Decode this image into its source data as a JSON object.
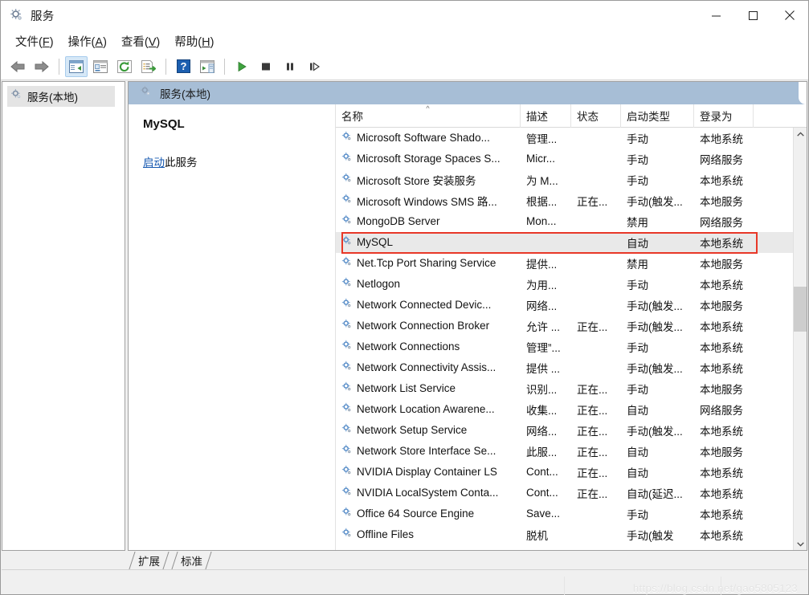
{
  "window": {
    "title": "服务",
    "icon": "services-gear-icon",
    "minimize_label": "最小化",
    "maximize_label": "最大化",
    "close_label": "关闭"
  },
  "menubar": {
    "items": [
      {
        "label": "文件(F)",
        "text": "文件(",
        "accel": "F",
        "tail": ")"
      },
      {
        "label": "操作(A)",
        "text": "操作(",
        "accel": "A",
        "tail": ")"
      },
      {
        "label": "查看(V)",
        "text": "查看(",
        "accel": "V",
        "tail": ")"
      },
      {
        "label": "帮助(H)",
        "text": "帮助(",
        "accel": "H",
        "tail": ")"
      }
    ]
  },
  "toolbar": {
    "buttons": [
      {
        "name": "back-icon",
        "title": "后退"
      },
      {
        "name": "forward-icon",
        "title": "前进"
      },
      {
        "name": "show-hide-tree-icon",
        "title": "显示/隐藏控制台树",
        "active": true
      },
      {
        "name": "properties-icon",
        "title": "属性"
      },
      {
        "name": "refresh-icon",
        "title": "刷新"
      },
      {
        "name": "export-list-icon",
        "title": "导出列表"
      },
      {
        "name": "help-icon",
        "title": "帮助"
      },
      {
        "name": "show-action-pane-icon",
        "title": "显示操作窗格"
      },
      {
        "name": "start-service-icon",
        "title": "启动服务"
      },
      {
        "name": "stop-service-icon",
        "title": "停止服务"
      },
      {
        "name": "pause-service-icon",
        "title": "暂停服务"
      },
      {
        "name": "restart-service-icon",
        "title": "重启服务"
      }
    ]
  },
  "tree": {
    "items": [
      {
        "label": "服务(本地)",
        "icon": "services-gear-icon",
        "selected": true
      }
    ]
  },
  "pane": {
    "header": "服务(本地)",
    "header_icon": "services-gear-icon",
    "service_name": "MySQL",
    "action_link": "启动",
    "action_tail": "此服务"
  },
  "grid": {
    "columns": [
      {
        "key": "name",
        "label": "名称",
        "sorted": "asc"
      },
      {
        "key": "desc",
        "label": "描述"
      },
      {
        "key": "state",
        "label": "状态"
      },
      {
        "key": "start",
        "label": "启动类型"
      },
      {
        "key": "logon",
        "label": "登录为"
      }
    ],
    "sort_caret": "^",
    "rows": [
      {
        "name": "Microsoft Software Shado...",
        "desc": "管理...",
        "state": "",
        "start": "手动",
        "logon": "本地系统"
      },
      {
        "name": "Microsoft Storage Spaces S...",
        "desc": "Micr...",
        "state": "",
        "start": "手动",
        "logon": "网络服务"
      },
      {
        "name": "Microsoft Store 安装服务",
        "desc": "为 M...",
        "state": "",
        "start": "手动",
        "logon": "本地系统"
      },
      {
        "name": "Microsoft Windows SMS 路...",
        "desc": "根据...",
        "state": "正在...",
        "start": "手动(触发...",
        "logon": "本地服务"
      },
      {
        "name": "MongoDB Server",
        "desc": "Mon...",
        "state": "",
        "start": "禁用",
        "logon": "网络服务"
      },
      {
        "name": "MySQL",
        "desc": "",
        "state": "",
        "start": "自动",
        "logon": "本地系统",
        "selected": true,
        "highlighted": true
      },
      {
        "name": "Net.Tcp Port Sharing Service",
        "desc": "提供...",
        "state": "",
        "start": "禁用",
        "logon": "本地服务"
      },
      {
        "name": "Netlogon",
        "desc": "为用...",
        "state": "",
        "start": "手动",
        "logon": "本地系统"
      },
      {
        "name": "Network Connected Devic...",
        "desc": "网络...",
        "state": "",
        "start": "手动(触发...",
        "logon": "本地服务"
      },
      {
        "name": "Network Connection Broker",
        "desc": "允许 ...",
        "state": "正在...",
        "start": "手动(触发...",
        "logon": "本地系统"
      },
      {
        "name": "Network Connections",
        "desc": "管理”...",
        "state": "",
        "start": "手动",
        "logon": "本地系统"
      },
      {
        "name": "Network Connectivity Assis...",
        "desc": "提供 ...",
        "state": "",
        "start": "手动(触发...",
        "logon": "本地系统"
      },
      {
        "name": "Network List Service",
        "desc": "识别...",
        "state": "正在...",
        "start": "手动",
        "logon": "本地服务"
      },
      {
        "name": "Network Location Awarene...",
        "desc": "收集...",
        "state": "正在...",
        "start": "自动",
        "logon": "网络服务"
      },
      {
        "name": "Network Setup Service",
        "desc": "网络...",
        "state": "正在...",
        "start": "手动(触发...",
        "logon": "本地系统"
      },
      {
        "name": "Network Store Interface Se...",
        "desc": "此服...",
        "state": "正在...",
        "start": "自动",
        "logon": "本地服务"
      },
      {
        "name": "NVIDIA Display Container LS",
        "desc": "Cont...",
        "state": "正在...",
        "start": "自动",
        "logon": "本地系统"
      },
      {
        "name": "NVIDIA LocalSystem Conta...",
        "desc": "Cont...",
        "state": "正在...",
        "start": "自动(延迟...",
        "logon": "本地系统"
      },
      {
        "name": "Office 64 Source Engine",
        "desc": "Save...",
        "state": "",
        "start": "手动",
        "logon": "本地系统"
      },
      {
        "name": "Offline Files",
        "desc": "脱机",
        "state": "",
        "start": "手动(触发",
        "logon": "本地系统"
      }
    ]
  },
  "tabs": [
    {
      "label": "扩展",
      "selected": false
    },
    {
      "label": "标准",
      "selected": true
    }
  ],
  "statusbar": {
    "watermark": "https://blog.csdn.net/gao5805123"
  },
  "colors": {
    "pane_header": "#a7bed6",
    "annotation": "#e83828",
    "link": "#1558b0",
    "selected_row": "#e9e9e9",
    "toolbar_active": "#d6e8f7"
  }
}
